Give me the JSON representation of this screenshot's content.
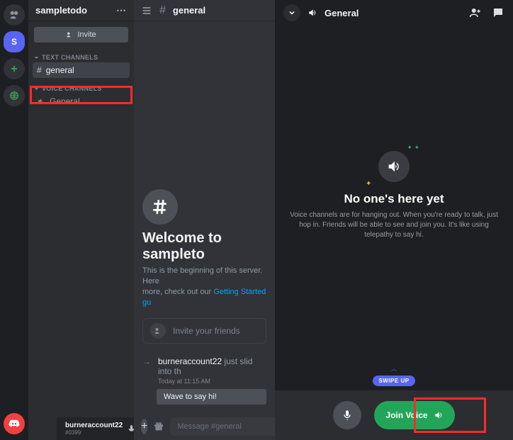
{
  "left": {
    "guilds": {
      "active_letter": "S"
    },
    "server": {
      "name": "sampletodo",
      "invite_button": "Invite"
    },
    "categories": {
      "text": {
        "label": "TEXT CHANNELS",
        "channel": "general"
      },
      "voice": {
        "label": "VOICE CHANNELS",
        "channel": "General"
      }
    },
    "user": {
      "name": "burneraccount22",
      "tag": "#0399"
    },
    "header": {
      "channel": "general"
    },
    "welcome": {
      "title": "Welcome to sampleto",
      "subtitle_a": "This is the beginning of this server. Here",
      "subtitle_b": "more, check out our ",
      "link": "Getting Started gu",
      "invite_friends": "Invite your friends"
    },
    "system": {
      "user": "burneraccount22",
      "text": " just slid into th",
      "timestamp": "Today at 11:15 AM",
      "wave": "Wave to say hi!"
    },
    "composer": {
      "placeholder": "Message #general"
    }
  },
  "right": {
    "header": {
      "title": "General"
    },
    "empty": {
      "title": "No one's here yet",
      "desc": "Voice channels are for hanging out. When you're ready to talk, just hop in. Friends will be able to see and join you. It's like using telepathy to say hi."
    },
    "swipe": "SWIPE UP",
    "join": "Join Voice"
  }
}
